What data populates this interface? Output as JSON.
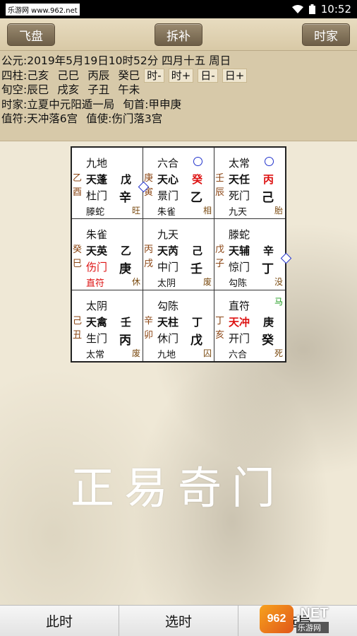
{
  "status_bar": {
    "watermark_left": "乐游网 www.962.net",
    "time": "10:52"
  },
  "toolbar": {
    "left_label": "飞盘",
    "center_label": "拆补",
    "right_label": "时家"
  },
  "info": {
    "gongyuan_prefix": "公元:",
    "gongyuan_value": "2019年5月19日10时52分 四月十五 周日",
    "sizhu_prefix": "四柱:",
    "sizhu": [
      "己亥",
      "己巳",
      "丙辰",
      "癸巳"
    ],
    "adjust_buttons": [
      "时-",
      "时+",
      "日-",
      "日+"
    ],
    "xunkong_prefix": "旬空:",
    "xunkong": [
      "辰巳",
      "戌亥",
      "子丑",
      "午未"
    ],
    "shijia_prefix": "时家:",
    "shijia_value": "立夏中元阳遁一局",
    "xunshou_prefix": "旬首:",
    "xunshou_value": "甲申庚",
    "zhifu_prefix": "值符:",
    "zhifu_value": "天冲落6宫",
    "zhishi_prefix": "值使:",
    "zhishi_value": "伤门落3宫"
  },
  "grid": [
    {
      "god_top": "九地",
      "side": [
        "乙",
        "酉"
      ],
      "star": "天蓬",
      "stem1": "戊",
      "door": "杜门",
      "stem2": "辛",
      "god_bottom": "滕蛇",
      "corner": "旺",
      "circle": false,
      "diamond": true,
      "horse": ""
    },
    {
      "god_top": "六合",
      "side": [
        "庚",
        "寅"
      ],
      "star": "天心",
      "stem1": "癸",
      "door": "景门",
      "stem2": "乙",
      "god_bottom": "朱雀",
      "corner": "相",
      "circle": true,
      "diamond": false,
      "horse": ""
    },
    {
      "god_top": "太常",
      "side": [
        "壬",
        "辰"
      ],
      "star": "天任",
      "stem1": "丙",
      "door": "死门",
      "stem2": "己",
      "god_bottom": "九天",
      "corner": "胎",
      "circle": true,
      "diamond": false,
      "horse": ""
    },
    {
      "god_top": "朱雀",
      "side": [
        "癸",
        "巳"
      ],
      "star": "天英",
      "stem1": "乙",
      "door": "伤门",
      "stem2": "庚",
      "god_bottom": "直符",
      "corner": "休",
      "circle": false,
      "diamond": false,
      "horse": ""
    },
    {
      "god_top": "九天",
      "side": [
        "丙",
        "戌"
      ],
      "star": "天芮",
      "stem1": "己",
      "door": "中门",
      "stem2": "壬",
      "god_bottom": "太阴",
      "corner": "废",
      "circle": false,
      "diamond": false,
      "horse": ""
    },
    {
      "god_top": "滕蛇",
      "side": [
        "戊",
        "子"
      ],
      "star": "天辅",
      "stem1": "辛",
      "door": "惊门",
      "stem2": "丁",
      "god_bottom": "勾陈",
      "corner": "没",
      "circle": false,
      "diamond": true,
      "horse": ""
    },
    {
      "god_top": "太阴",
      "side": [
        "己",
        "丑"
      ],
      "star": "天禽",
      "stem1": "壬",
      "door": "生门",
      "stem2": "丙",
      "god_bottom": "太常",
      "corner": "废",
      "circle": false,
      "diamond": false,
      "horse": ""
    },
    {
      "god_top": "勾陈",
      "side": [
        "辛",
        "卯"
      ],
      "star": "天柱",
      "stem1": "丁",
      "door": "休门",
      "stem2": "戊",
      "god_bottom": "九地",
      "corner": "囚",
      "circle": false,
      "diamond": false,
      "horse": ""
    },
    {
      "god_top": "直符",
      "side": [
        "丁",
        "亥"
      ],
      "star": "天冲",
      "stem1": "庚",
      "door": "开门",
      "stem2": "癸",
      "god_bottom": "六合",
      "corner": "死",
      "circle": false,
      "diamond": false,
      "horse": "马"
    }
  ],
  "title_art": "正易奇门",
  "bottom_bar": {
    "btn1": "此时",
    "btn2": "选时",
    "btn3": "选局"
  },
  "watermark": {
    "logo_text": "962",
    "net_text": ".NET",
    "sub_text": "乐游网"
  }
}
